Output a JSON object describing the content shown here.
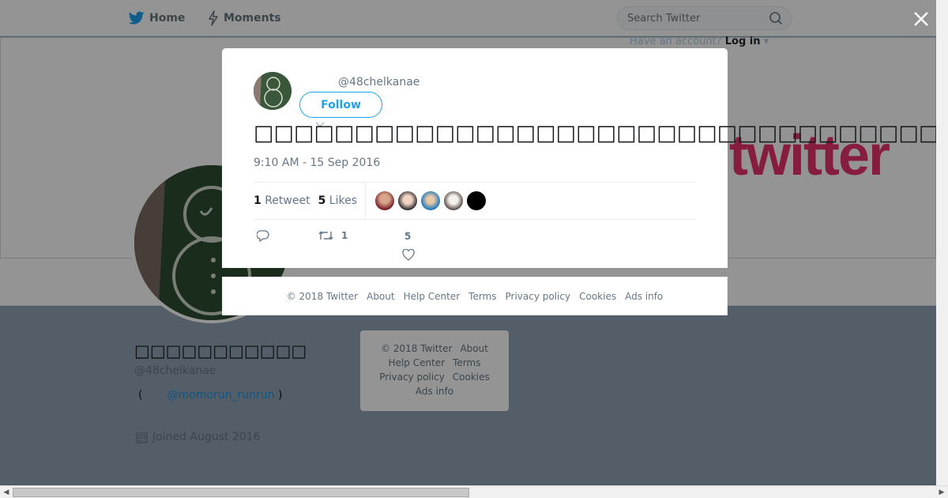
{
  "topnav": {
    "home_label": "Home",
    "moments_label": "Moments",
    "search_placeholder": "Search Twitter",
    "have_account": "Have an account?",
    "login_label": "Log in"
  },
  "banner": {
    "logo_text": "twitter"
  },
  "profile": {
    "name": "□□□□□□□□□□□",
    "handle": "@48chelkanae",
    "bio_prefix": "(",
    "bio_link": "@momorun_runrun",
    "bio_suffix": ")",
    "joined": "Joined August 2016"
  },
  "background_footer": {
    "items": [
      "© 2018 Twitter",
      "About",
      "Help Center",
      "Terms",
      "Privacy policy",
      "Cookies",
      "Ads info"
    ]
  },
  "modal": {
    "handle": "@48chelkanae",
    "follow_label": "Follow",
    "tweet_text": "□□□□□□□□□□□□□□□□□□□□□□□□□□□□□□□□□□□□□□□□□□□□□□□□□□□□□□□□□□□□□",
    "timestamp": "9:10 AM - 15 Sep 2016",
    "retweet_count": "1",
    "retweet_label": "Retweet",
    "likes_count": "5",
    "likes_label": "Likes",
    "action_retweet_count": "1",
    "action_like_count": "5"
  },
  "modal_footer": {
    "items": [
      "© 2018 Twitter",
      "About",
      "Help Center",
      "Terms",
      "Privacy policy",
      "Cookies",
      "Ads info"
    ]
  },
  "colors": {
    "twitter_blue": "#1da1f2",
    "link_blue": "#1b95e0",
    "banner_logo": "#e8336b"
  }
}
